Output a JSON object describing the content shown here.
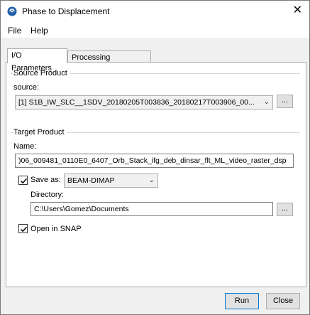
{
  "window": {
    "title": "Phase to Displacement",
    "icons": {
      "app": "snap-app-icon",
      "close": "close-icon"
    },
    "close_glyph": "✕"
  },
  "menu": {
    "items": [
      "File",
      "Help"
    ]
  },
  "tabs": [
    {
      "label": "I/O Parameters",
      "active": true
    },
    {
      "label": "Processing Parameters",
      "active": false
    }
  ],
  "source": {
    "group_title": "Source Product",
    "source_label": "source:",
    "selected_value": "[1] S1B_IW_SLC__1SDV_20180205T003836_20180217T003906_00...",
    "browse_label": "..."
  },
  "target": {
    "group_title": "Target Product",
    "name_label": "Name:",
    "name_value": ")06_009481_0110E0_6407_Orb_Stack_ifg_deb_dinsar_flt_ML_video_raster_dsp",
    "save_as_label": "Save as:",
    "save_as_checked": true,
    "format_value": "BEAM-DIMAP",
    "directory_label": "Directory:",
    "directory_value": "C:\\Users\\Gomez\\Documents",
    "browse_label": "...",
    "open_in_snap_label": "Open in SNAP",
    "open_in_snap_checked": true
  },
  "buttons": {
    "run": "Run",
    "close": "Close"
  },
  "colors": {
    "accent": "#0078d7",
    "icon_blue": "#1f5fa8"
  }
}
